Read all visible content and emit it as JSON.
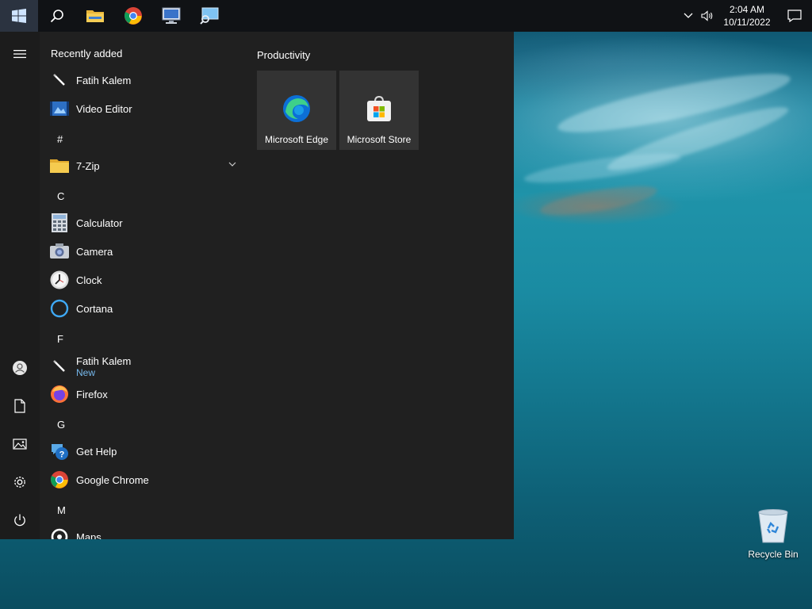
{
  "taskbar": {
    "pinned": [
      {
        "name": "start",
        "icon": "windows-logo-icon"
      },
      {
        "name": "search",
        "icon": "search-icon"
      },
      {
        "name": "file-explorer",
        "icon": "folder-icon"
      },
      {
        "name": "google-chrome",
        "icon": "chrome-icon"
      },
      {
        "name": "remote-desktop",
        "icon": "computer-network-icon"
      },
      {
        "name": "network-search",
        "icon": "monitor-search-icon"
      }
    ],
    "clock": {
      "time": "2:04 AM",
      "date": "10/11/2022"
    }
  },
  "start_menu": {
    "recently_added_label": "Recently added",
    "recently_added": [
      {
        "label": "Fatih Kalem",
        "icon": "pen-icon"
      },
      {
        "label": "Video Editor",
        "icon": "video-editor-icon"
      }
    ],
    "groups": [
      {
        "letter": "#",
        "apps": [
          {
            "label": "7-Zip",
            "icon": "folder-icon",
            "expandable": true
          }
        ]
      },
      {
        "letter": "C",
        "apps": [
          {
            "label": "Calculator",
            "icon": "calculator-icon"
          },
          {
            "label": "Camera",
            "icon": "camera-icon"
          },
          {
            "label": "Clock",
            "icon": "clock-icon"
          },
          {
            "label": "Cortana",
            "icon": "cortana-icon"
          }
        ]
      },
      {
        "letter": "F",
        "apps": [
          {
            "label": "Fatih Kalem",
            "sub": "New",
            "icon": "pen-icon"
          },
          {
            "label": "Firefox",
            "icon": "firefox-icon"
          }
        ]
      },
      {
        "letter": "G",
        "apps": [
          {
            "label": "Get Help",
            "icon": "help-icon"
          },
          {
            "label": "Google Chrome",
            "icon": "chrome-icon"
          }
        ]
      },
      {
        "letter": "M",
        "apps": [
          {
            "label": "Maps",
            "icon": "maps-icon"
          }
        ]
      }
    ],
    "tiles_group_label": "Productivity",
    "tiles": [
      {
        "label": "Microsoft Edge",
        "icon": "edge-icon"
      },
      {
        "label": "Microsoft Store",
        "icon": "store-icon"
      }
    ],
    "rail": [
      "menu-icon",
      "user-icon",
      "documents-icon",
      "pictures-icon",
      "settings-icon",
      "power-icon"
    ]
  },
  "desktop": {
    "icons": [
      {
        "label": "Recycle Bin",
        "icon": "recycle-bin-icon"
      }
    ]
  },
  "colors": {
    "taskbar": "#101215",
    "start_bg": "#202020",
    "tile_bg": "#333333",
    "accent": "#76b9ed"
  }
}
